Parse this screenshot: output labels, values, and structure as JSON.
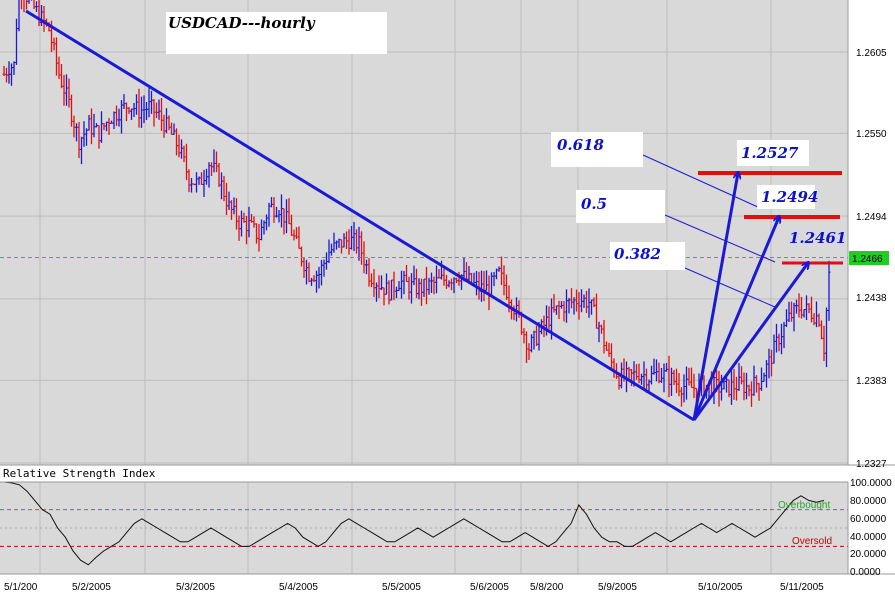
{
  "chart_data": [
    {
      "type": "ohlc",
      "title": "USDCAD---hourly",
      "y_ticks": [
        "1.2605",
        "1.2550",
        "1.2494",
        "1.2438",
        "1.2383",
        "1.2327"
      ],
      "ylim": [
        1.2327,
        1.266
      ],
      "current_price": "1.2466",
      "x_labels": [
        "5/1/200",
        "5/2/2005",
        "5/3/2005",
        "5/4/2005",
        "5/5/2005",
        "5/6/2005",
        "5/8/200",
        "5/9/2005",
        "5/10/2005",
        "5/11/2005"
      ],
      "grid": true,
      "price_path": [
        [
          0,
          1.259
        ],
        [
          2,
          1.2595
        ],
        [
          4,
          1.2596
        ],
        [
          6,
          1.2652
        ],
        [
          10,
          1.264
        ],
        [
          14,
          1.263
        ],
        [
          18,
          1.262
        ],
        [
          22,
          1.259
        ],
        [
          26,
          1.257
        ],
        [
          30,
          1.2545
        ],
        [
          34,
          1.2555
        ],
        [
          38,
          1.255
        ],
        [
          42,
          1.256
        ],
        [
          46,
          1.2565
        ],
        [
          50,
          1.257
        ],
        [
          54,
          1.2565
        ],
        [
          58,
          1.2568
        ],
        [
          62,
          1.2562
        ],
        [
          66,
          1.2552
        ],
        [
          70,
          1.254
        ],
        [
          74,
          1.252
        ],
        [
          78,
          1.2515
        ],
        [
          82,
          1.253
        ],
        [
          86,
          1.252
        ],
        [
          90,
          1.25
        ],
        [
          94,
          1.249
        ],
        [
          98,
          1.2488
        ],
        [
          102,
          1.248
        ],
        [
          106,
          1.25
        ],
        [
          110,
          1.25
        ],
        [
          114,
          1.2488
        ],
        [
          118,
          1.247
        ],
        [
          122,
          1.2455
        ],
        [
          126,
          1.2455
        ],
        [
          130,
          1.247
        ],
        [
          134,
          1.2475
        ],
        [
          138,
          1.2478
        ],
        [
          142,
          1.2475
        ],
        [
          146,
          1.2455
        ],
        [
          150,
          1.2448
        ],
        [
          154,
          1.2443
        ],
        [
          158,
          1.245
        ],
        [
          162,
          1.2447
        ],
        [
          166,
          1.2445
        ],
        [
          170,
          1.2447
        ],
        [
          174,
          1.245
        ],
        [
          178,
          1.2452
        ],
        [
          182,
          1.2455
        ],
        [
          186,
          1.245
        ],
        [
          190,
          1.2445
        ],
        [
          194,
          1.2445
        ],
        [
          198,
          1.2455
        ],
        [
          202,
          1.244
        ],
        [
          206,
          1.2425
        ],
        [
          210,
          1.2405
        ],
        [
          214,
          1.2415
        ],
        [
          218,
          1.2425
        ],
        [
          222,
          1.2432
        ],
        [
          226,
          1.2435
        ],
        [
          230,
          1.2438
        ],
        [
          234,
          1.2436
        ],
        [
          238,
          1.242
        ],
        [
          242,
          1.2398
        ],
        [
          246,
          1.2385
        ],
        [
          250,
          1.2385
        ],
        [
          254,
          1.2388
        ],
        [
          258,
          1.2385
        ],
        [
          262,
          1.2388
        ],
        [
          266,
          1.2385
        ],
        [
          270,
          1.238
        ],
        [
          274,
          1.2378
        ],
        [
          278,
          1.2378
        ],
        [
          282,
          1.238
        ],
        [
          286,
          1.2378
        ],
        [
          290,
          1.2378
        ],
        [
          294,
          1.238
        ],
        [
          298,
          1.2378
        ],
        [
          302,
          1.2382
        ],
        [
          306,
          1.2395
        ],
        [
          310,
          1.2412
        ],
        [
          314,
          1.2425
        ],
        [
          318,
          1.2432
        ],
        [
          322,
          1.243
        ],
        [
          326,
          1.2425
        ],
        [
          328,
          1.2405
        ],
        [
          330,
          1.2455
        ]
      ],
      "rsi": {
        "title": "Relative Strength Index",
        "y_ticks": [
          "100.0000",
          "80.0000",
          "60.0000",
          "40.0000",
          "20.0000",
          "0.0000"
        ],
        "overbought_label": "Overbought",
        "oversold_label": "Oversold",
        "overbought": 70,
        "oversold": 30,
        "values": [
          100,
          99,
          97,
          90,
          80,
          70,
          65,
          50,
          40,
          25,
          15,
          10,
          18,
          25,
          30,
          35,
          45,
          55,
          60,
          55,
          50,
          45,
          40,
          35,
          35,
          40,
          45,
          50,
          45,
          40,
          35,
          30,
          30,
          35,
          40,
          45,
          50,
          55,
          50,
          40,
          35,
          30,
          35,
          45,
          55,
          60,
          55,
          50,
          45,
          40,
          35,
          35,
          40,
          45,
          50,
          45,
          40,
          45,
          50,
          55,
          60,
          55,
          50,
          45,
          40,
          35,
          35,
          40,
          45,
          40,
          35,
          30,
          35,
          45,
          55,
          75,
          65,
          50,
          40,
          35,
          35,
          30,
          30,
          35,
          40,
          45,
          40,
          35,
          40,
          45,
          50,
          55,
          50,
          45,
          50,
          55,
          50,
          45,
          40,
          45,
          50,
          60,
          70,
          80,
          85,
          80,
          78,
          80
        ]
      },
      "fib_labels": [
        "0.618",
        "0.5",
        "0.382"
      ],
      "fib_targets": [
        "1.2527",
        "1.2494",
        "1.2461"
      ]
    }
  ]
}
